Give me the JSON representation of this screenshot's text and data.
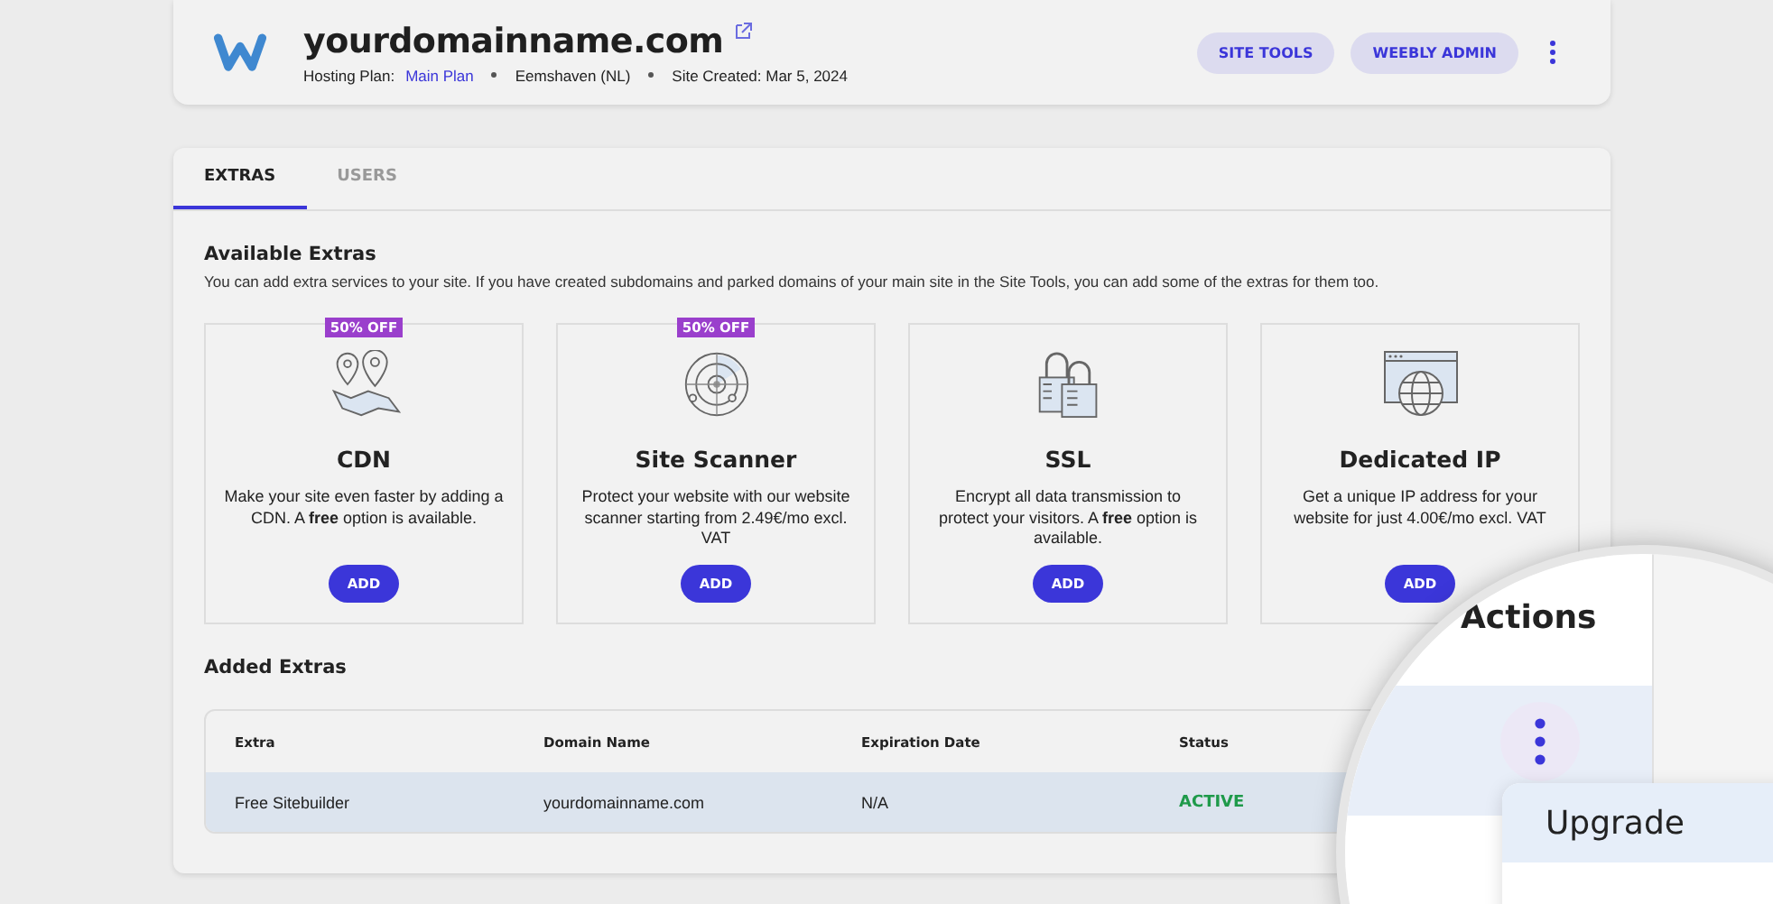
{
  "header": {
    "domain": "yourdomainname.com",
    "plan_label": "Hosting Plan:",
    "plan": "Main Plan",
    "meta": [
      "Eemshaven (NL)",
      "Site Created: Mar 5, 2024"
    ],
    "buttons": [
      "SITE TOOLS",
      "WEEBLY ADMIN"
    ]
  },
  "tabs": [
    {
      "label": "EXTRAS",
      "selected": true
    },
    {
      "label": "USERS",
      "selected": false
    }
  ],
  "available_extras": {
    "title": "Available Extras",
    "description": "You can add extra services to your site. If you have created subdomains and parked domains of your main site in the Site Tools, you can add some of the extras for them too.",
    "items": [
      {
        "badge": "50% OFF",
        "name": "CDN",
        "description": "Make your site even faster by adding a CDN. A **free** option is available.",
        "button": "ADD"
      },
      {
        "badge": "50% OFF",
        "name": "Site Scanner",
        "description": "Protect your website with our website scanner starting from 2.49€/mo excl. VAT",
        "button": "ADD"
      },
      {
        "name": "SSL",
        "description": "Encrypt all data transmission to protect your visitors. A **free** option is available.",
        "button": "ADD"
      },
      {
        "name": "Dedicated IP",
        "description": "Get a unique IP address for your website for just 4.00€/mo excl. VAT",
        "button": "ADD"
      }
    ]
  },
  "added_extras": {
    "title": "Added Extras",
    "columns": [
      "Extra",
      "Domain Name",
      "Expiration Date",
      "Status"
    ],
    "rows": [
      {
        "cells": [
          "Free Sitebuilder",
          "yourdomainname.com",
          "N/A"
        ],
        "status": "ACTIVE",
        "selected": true
      }
    ]
  },
  "magnifier": {
    "column_heading": "Actions",
    "row_selected": true,
    "menu": [
      {
        "label": "Upgrade",
        "selected": true
      }
    ]
  }
}
